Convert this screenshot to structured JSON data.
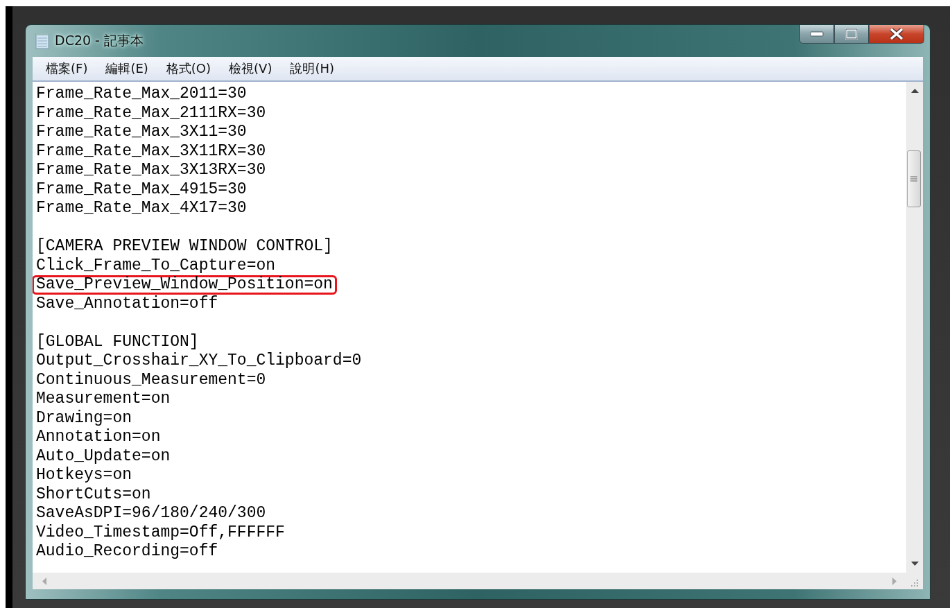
{
  "window": {
    "title": "DC20 - 記事本"
  },
  "menu": [
    {
      "label": "檔案(F)"
    },
    {
      "label": "編輯(E)"
    },
    {
      "label": "格式(O)"
    },
    {
      "label": "檢視(V)"
    },
    {
      "label": "說明(H)"
    }
  ],
  "editor": {
    "sections": [
      {
        "lines": [
          {
            "text": "Frame_Rate_Max_2011=30",
            "highlighted": false
          },
          {
            "text": "Frame_Rate_Max_2111RX=30",
            "highlighted": false
          },
          {
            "text": "Frame_Rate_Max_3X11=30",
            "highlighted": false
          },
          {
            "text": "Frame_Rate_Max_3X11RX=30",
            "highlighted": false
          },
          {
            "text": "Frame_Rate_Max_3X13RX=30",
            "highlighted": false
          },
          {
            "text": "Frame_Rate_Max_4915=30",
            "highlighted": false
          },
          {
            "text": "Frame_Rate_Max_4X17=30",
            "highlighted": false
          }
        ]
      },
      {
        "lines": [
          {
            "text": "[CAMERA PREVIEW WINDOW CONTROL]",
            "highlighted": false
          },
          {
            "text": "Click_Frame_To_Capture=on",
            "highlighted": false
          },
          {
            "text": "Save_Preview_Window_Position=on",
            "highlighted": true
          },
          {
            "text": "Save_Annotation=off",
            "highlighted": false
          }
        ]
      },
      {
        "lines": [
          {
            "text": "[GLOBAL FUNCTION]",
            "highlighted": false
          },
          {
            "text": "Output_Crosshair_XY_To_Clipboard=0",
            "highlighted": false
          },
          {
            "text": "Continuous_Measurement=0",
            "highlighted": false
          },
          {
            "text": "Measurement=on",
            "highlighted": false
          },
          {
            "text": "Drawing=on",
            "highlighted": false
          },
          {
            "text": "Annotation=on",
            "highlighted": false
          },
          {
            "text": "Auto_Update=on",
            "highlighted": false
          },
          {
            "text": "Hotkeys=on",
            "highlighted": false
          },
          {
            "text": "ShortCuts=on",
            "highlighted": false
          },
          {
            "text": "SaveAsDPI=96/180/240/300",
            "highlighted": false
          },
          {
            "text": "Video_Timestamp=Off,FFFFFF",
            "highlighted": false
          },
          {
            "text": "Audio_Recording=off",
            "highlighted": false
          }
        ]
      }
    ]
  }
}
